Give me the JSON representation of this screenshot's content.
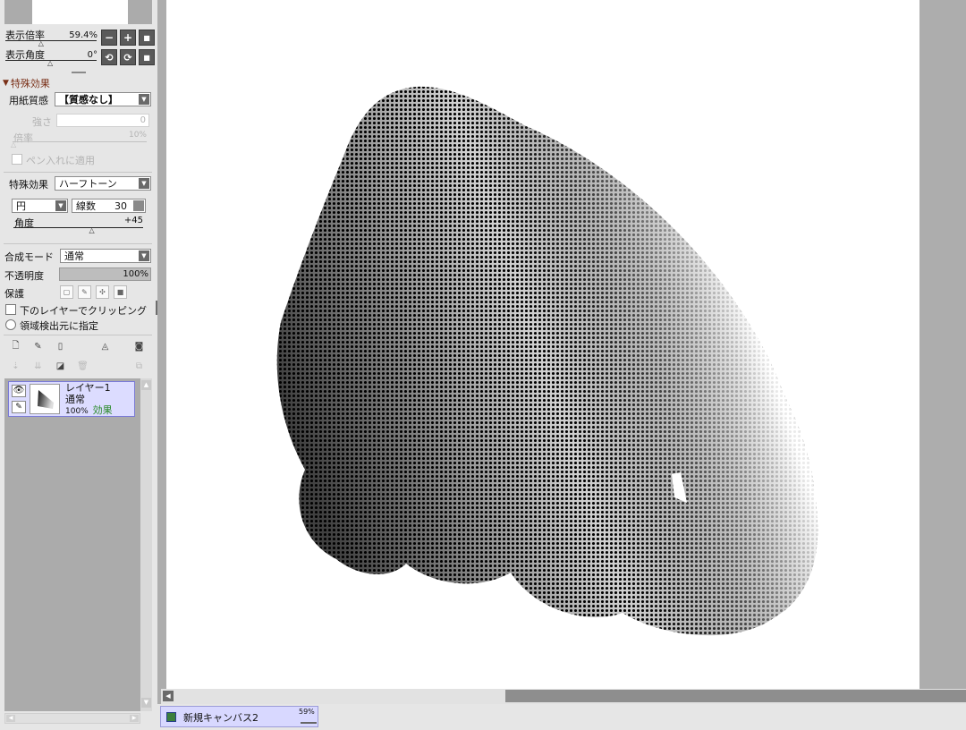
{
  "navigator": {
    "zoom_label": "表示倍率",
    "zoom_value": "59.4%",
    "zoom_level_fraction": 0.4,
    "angle_label": "表示角度",
    "angle_value": "0°",
    "angle_level_fraction": 0.5,
    "zoom_buttons": [
      "−",
      "+",
      "■"
    ],
    "rotate_buttons": [
      "⟲",
      "⟳",
      "■"
    ]
  },
  "effects": {
    "section_title": "特殊効果",
    "paper_texture_label": "用紙質感",
    "paper_texture_value": "【質感なし】",
    "strength_label": "強さ",
    "strength_value": "0",
    "scale_label": "倍率",
    "scale_value": "10%",
    "apply_pen_label": "ペン入れに適用",
    "effect_label": "特殊効果",
    "effect_value": "ハーフトーン",
    "shape_value": "円",
    "lines_label": "線数",
    "lines_value": "30",
    "angle_label": "角度",
    "angle_value": "+45",
    "angle_level_fraction": 0.61
  },
  "layer_props": {
    "blend_label": "合成モード",
    "blend_value": "通常",
    "opacity_label": "不透明度",
    "opacity_value": "100%",
    "opacity_fraction": 1.0,
    "protect_label": "保護",
    "clip_label": "下のレイヤーでクリッピング",
    "selection_source_label": "領域検出元に指定"
  },
  "layers": [
    {
      "name": "レイヤー1",
      "blend": "通常",
      "opacity": "100%",
      "effect_tag": "効果"
    }
  ],
  "colors": {
    "effect_tag": "#2a8a2a",
    "layer_selected_bg": "#dcdcff",
    "section_title": "#7a3018"
  },
  "tabs": [
    {
      "label": "新規キャンバス2",
      "zoom": "59%"
    }
  ]
}
